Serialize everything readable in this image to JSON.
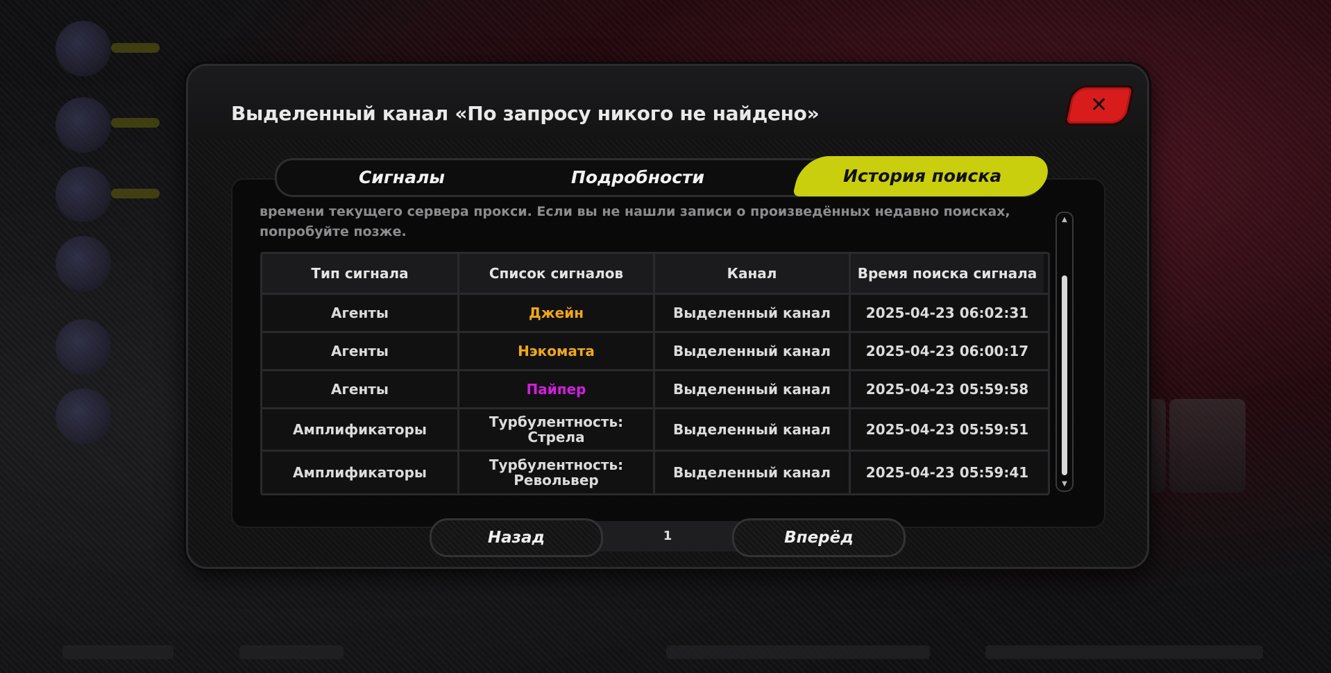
{
  "dialog": {
    "title": "Выделенный канал «По запросу никого не найдено»",
    "close_icon": "close-icon"
  },
  "tabs": [
    {
      "label": "Сигналы",
      "active": false
    },
    {
      "label": "Подробности",
      "active": false
    },
    {
      "label": "История поиска",
      "active": true
    }
  ],
  "description": "времени текущего сервера прокси. Если вы не нашли записи о произведённых недавно поисках, попробуйте позже.",
  "table": {
    "headers": [
      "Тип сигнала",
      "Список сигналов",
      "Канал",
      "Время поиска сигнала"
    ],
    "rows": [
      {
        "type": "Агенты",
        "signal": "Джейн",
        "signal_color": "#f0a81a",
        "channel": "Выделенный канал",
        "time": "2025-04-23 06:02:31"
      },
      {
        "type": "Агенты",
        "signal": "Нэкомата",
        "signal_color": "#f0a81a",
        "channel": "Выделенный канал",
        "time": "2025-04-23 06:00:17"
      },
      {
        "type": "Агенты",
        "signal": "Пайпер",
        "signal_color": "#d21fe0",
        "channel": "Выделенный канал",
        "time": "2025-04-23 05:59:58"
      },
      {
        "type": "Амплификаторы",
        "signal": "Турбулентность: Стрела",
        "signal_color": "#dcdcdc",
        "channel": "Выделенный канал",
        "time": "2025-04-23 05:59:51"
      },
      {
        "type": "Амплификаторы",
        "signal": "Турбулентность: Револьвер",
        "signal_color": "#dcdcdc",
        "channel": "Выделенный канал",
        "time": "2025-04-23 05:59:41"
      }
    ]
  },
  "pager": {
    "prev_label": "Назад",
    "page": "1",
    "next_label": "Вперёд"
  },
  "colors": {
    "accent": "#c9cf0d",
    "close": "#d81c1c",
    "orange_signal": "#f0a81a",
    "purple_signal": "#d21fe0"
  }
}
